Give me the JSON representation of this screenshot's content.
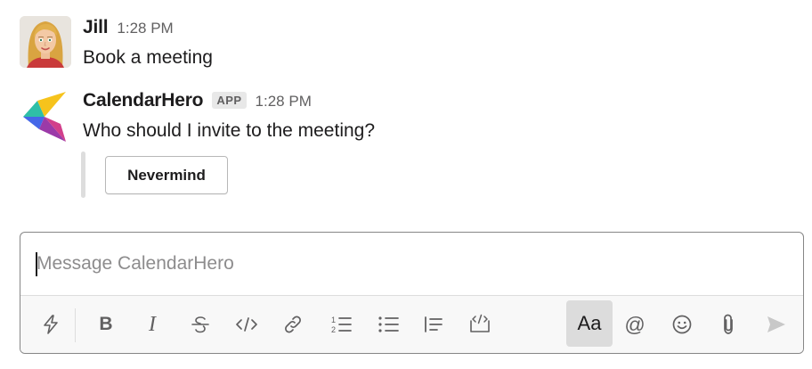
{
  "messages": [
    {
      "sender": "Jill",
      "time": "1:28 PM",
      "text": "Book a meeting",
      "avatar": "jill-avatar"
    },
    {
      "sender": "CalendarHero",
      "badge": "APP",
      "time": "1:28 PM",
      "text": "Who should I invite to the meeting?",
      "avatar": "calendarhero-logo",
      "actions": [
        {
          "label": "Nevermind"
        }
      ]
    }
  ],
  "composer": {
    "placeholder": "Message CalendarHero",
    "value": ""
  },
  "toolbar": {
    "items": [
      {
        "name": "shortcuts",
        "icon": "lightning-icon"
      },
      {
        "name": "bold",
        "label": "B",
        "icon": "bold-icon"
      },
      {
        "name": "italic",
        "label": "I",
        "icon": "italic-icon"
      },
      {
        "name": "strikethrough",
        "icon": "strikethrough-icon"
      },
      {
        "name": "code",
        "icon": "code-icon"
      },
      {
        "name": "link",
        "icon": "link-icon"
      },
      {
        "name": "ordered-list",
        "icon": "ordered-list-icon"
      },
      {
        "name": "bulleted-list",
        "icon": "bulleted-list-icon"
      },
      {
        "name": "blockquote",
        "icon": "blockquote-icon"
      },
      {
        "name": "code-block",
        "icon": "code-block-icon"
      },
      {
        "name": "formatting",
        "label": "Aa",
        "icon": "formatting-icon",
        "active": true
      },
      {
        "name": "mention",
        "label": "@",
        "icon": "at-icon"
      },
      {
        "name": "emoji",
        "icon": "emoji-icon"
      },
      {
        "name": "attach",
        "icon": "paperclip-icon"
      },
      {
        "name": "send",
        "icon": "send-icon"
      }
    ]
  },
  "colors": {
    "text": "#1d1c1d",
    "muted": "#616061",
    "badge_bg": "#e8e8e8",
    "logo_yellow": "#f6c31c",
    "logo_teal": "#2fbfa7",
    "logo_blue": "#4567e8",
    "logo_purple": "#9b3aa8",
    "logo_pink": "#d23f8b"
  }
}
